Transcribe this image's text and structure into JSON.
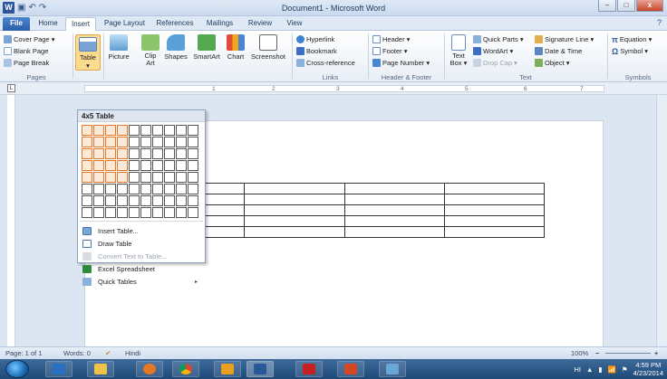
{
  "window": {
    "title": "Document1 - Microsoft Word",
    "min": "–",
    "max": "□",
    "close": "x"
  },
  "qat": {
    "logo": "W",
    "save": "💾",
    "undo": "↶",
    "redo": "↷"
  },
  "tabs": [
    "File",
    "Home",
    "Insert",
    "Page Layout",
    "References",
    "Mailings",
    "Review",
    "View"
  ],
  "active_tab": "Insert",
  "help_icon": "?",
  "ribbon": {
    "pages": {
      "items": [
        "Cover Page ▾",
        "Blank Page",
        "Page Break"
      ],
      "label": "Pages"
    },
    "tables": {
      "button": "Table",
      "arrow": "▾"
    },
    "illustrations": {
      "buttons": [
        "Picture",
        "Clip\nArt",
        "Shapes",
        "SmartArt",
        "Chart",
        "Screenshot"
      ],
      "label_partial": "ions"
    },
    "links": {
      "items": [
        "Hyperlink",
        "Bookmark",
        "Cross-reference"
      ],
      "label": "Links"
    },
    "header_footer": {
      "items": [
        "Header ▾",
        "Footer ▾",
        "Page Number ▾"
      ],
      "label": "Header & Footer"
    },
    "text": {
      "textbox": "Text\nBox ▾",
      "items": [
        "Quick Parts ▾",
        "WordArt ▾",
        "Drop Cap ▾",
        "Signature Line ▾",
        "Date & Time",
        "Object ▾"
      ],
      "label": "Text"
    },
    "symbols": {
      "items": [
        "Equation ▾",
        "Symbol ▾"
      ],
      "label": "Symbols"
    }
  },
  "ruler": {
    "numbers": [
      "1",
      "2",
      "3",
      "4",
      "5",
      "6",
      "7"
    ],
    "corner": "L"
  },
  "table_menu": {
    "header": "4x5 Table",
    "items": [
      {
        "label": "Insert Table...",
        "icon": "insert-table-icon",
        "disabled": false
      },
      {
        "label": "Draw Table",
        "icon": "draw-table-icon",
        "disabled": false
      },
      {
        "label": "Convert Text to Table...",
        "icon": "convert-text-icon",
        "disabled": true
      },
      {
        "label": "Excel Spreadsheet",
        "icon": "excel-icon",
        "disabled": false
      },
      {
        "label": "Quick Tables",
        "icon": "quick-tables-icon",
        "disabled": false,
        "submenu": "▸"
      }
    ],
    "grid": {
      "cols": 10,
      "rows": 8,
      "selected_cols": 4,
      "selected_rows": 5
    }
  },
  "document_table": {
    "rows": 5,
    "cols": 4
  },
  "status": {
    "page": "Page: 1 of 1",
    "words": "Words: 0",
    "lang": "Hindi",
    "zoom": "100%",
    "zoom_minus": "−",
    "zoom_plus": "+"
  },
  "tray": {
    "lang": "HI",
    "time": "4:59 PM",
    "date": "4/23/2014"
  },
  "colors": {
    "file_tab": "#2a5eaa",
    "selection": "#e5772c",
    "taskbar": "#1f4a78"
  }
}
